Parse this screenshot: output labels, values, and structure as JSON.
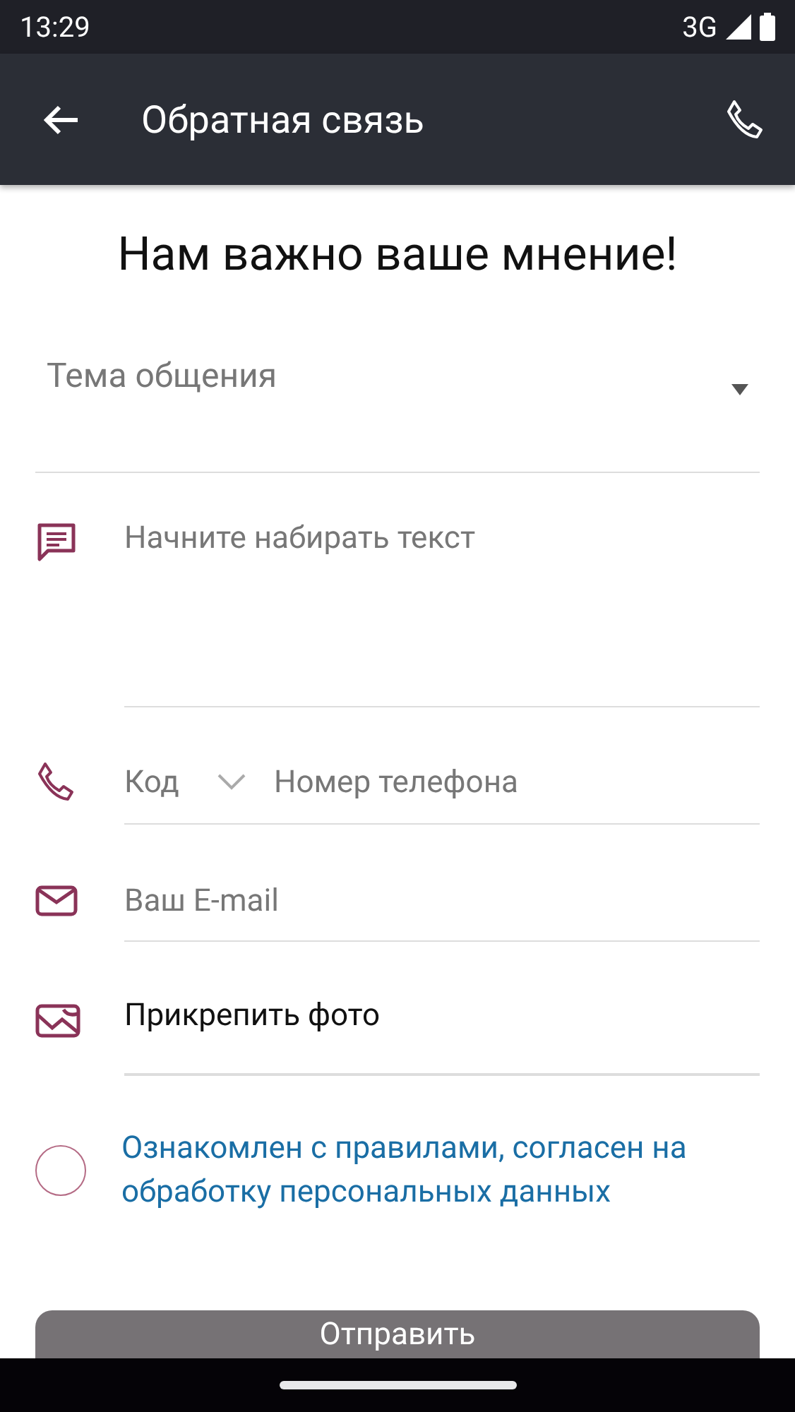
{
  "status_bar": {
    "time": "13:29",
    "network": "3G"
  },
  "app_bar": {
    "title": "Обратная связь"
  },
  "heading": "Нам важно ваше мнение!",
  "topic": {
    "placeholder": "Тема общения"
  },
  "message": {
    "placeholder": "Начните набирать текст"
  },
  "phone": {
    "code": {
      "placeholder": "Код"
    },
    "number": {
      "placeholder": "Номер телефона"
    }
  },
  "email": {
    "placeholder": "Ваш E-mail"
  },
  "attach": {
    "label": "Прикрепить фото"
  },
  "consent": {
    "text": "Ознакомлен с правилами, согласен на обработку персональных данных",
    "checked": false
  },
  "submit": {
    "label": "Отправить",
    "disabled": true
  }
}
